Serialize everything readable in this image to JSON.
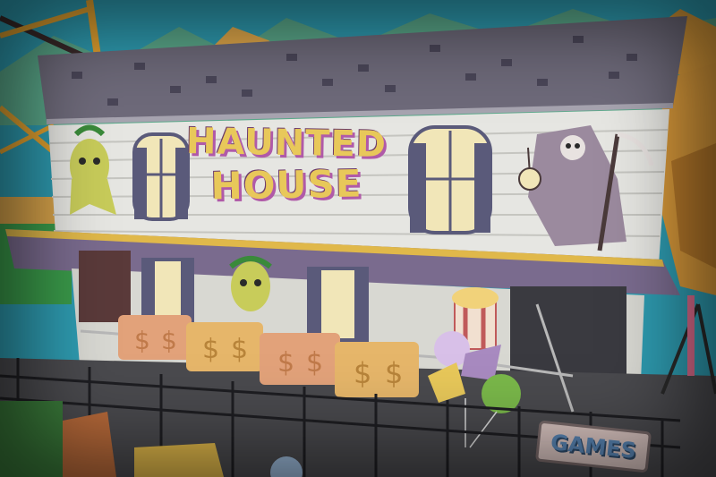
{
  "scene": {
    "main_sign_line1": "HAUNTED",
    "main_sign_line2": "HOUSE",
    "games_sign": "GAMES"
  },
  "colors": {
    "sky": "#2e9bb0",
    "roof": "#6e6a7a",
    "wall": "#e6e6e2",
    "sign_text": "#e8c85a",
    "sign_outline": "#b05aa8",
    "awning": "#7a6b8e",
    "cart": "#e2b26a",
    "ground": "#4a4a4e"
  }
}
